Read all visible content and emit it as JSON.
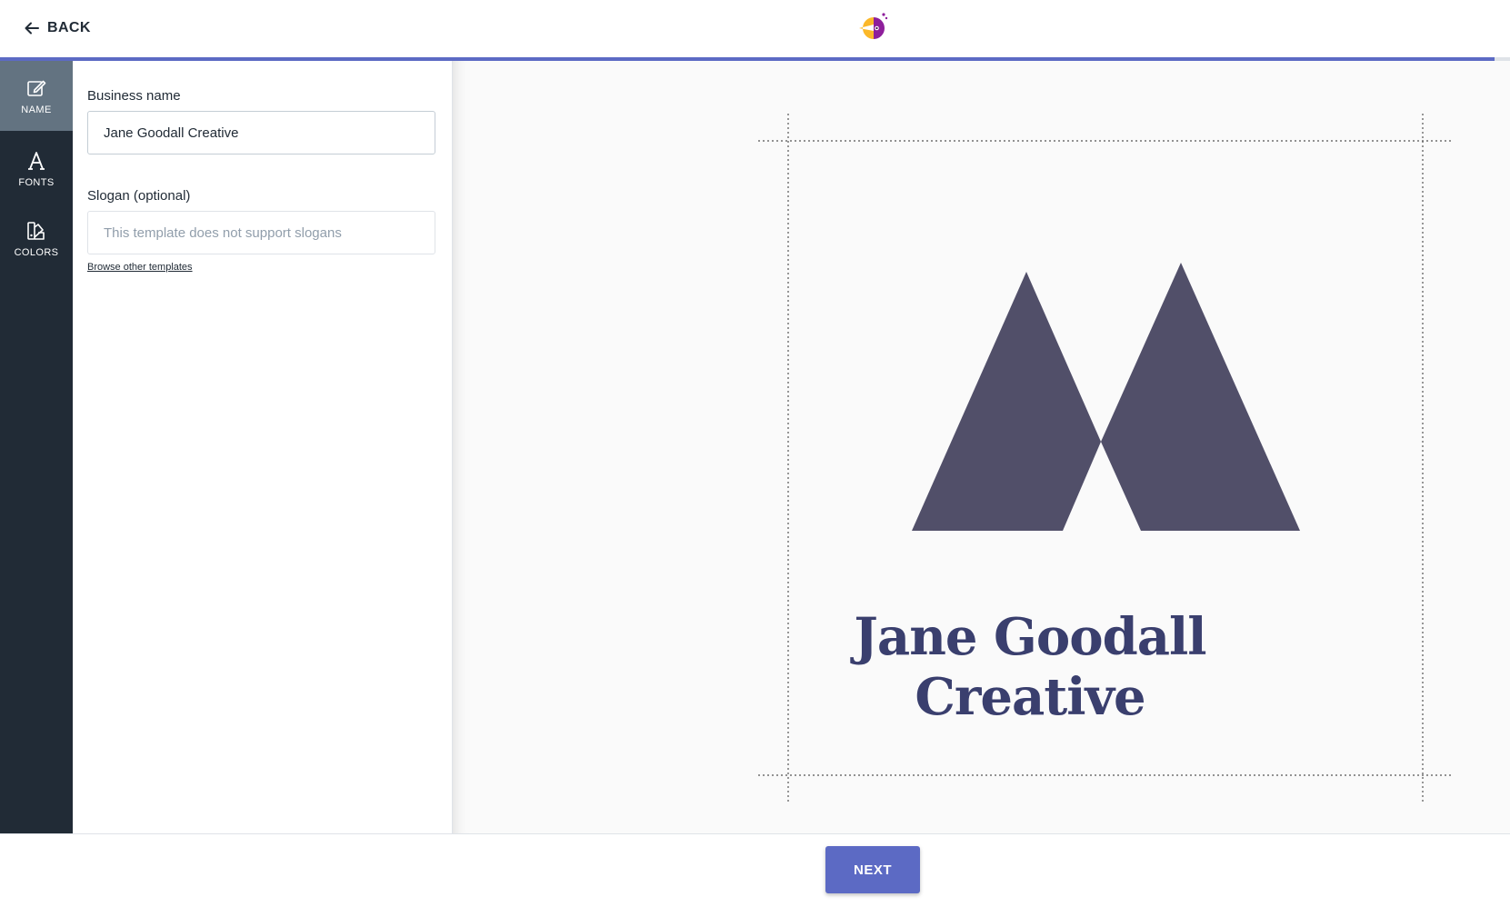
{
  "header": {
    "back_label": "BACK",
    "logo_icon": "brand-bird-logo-icon",
    "progress_fraction": 0.99,
    "accent_color": "#5c6ac4"
  },
  "sidebar": {
    "items": [
      {
        "label": "NAME",
        "icon": "edit-icon",
        "active": true
      },
      {
        "label": "FONTS",
        "icon": "font-icon",
        "active": false
      },
      {
        "label": "COLORS",
        "icon": "palette-icon",
        "active": false
      }
    ]
  },
  "form": {
    "business_name_label": "Business name",
    "business_name_value": "Jane Goodall Creative",
    "slogan_label": "Slogan (optional)",
    "slogan_placeholder": "This template does not support slogans",
    "browse_link": "Browse other templates"
  },
  "preview": {
    "brand_name": "Jane Goodall Creative",
    "mark_color": "#514f69",
    "name_color": "#3a3f6e"
  },
  "footer": {
    "next_label": "NEXT"
  }
}
